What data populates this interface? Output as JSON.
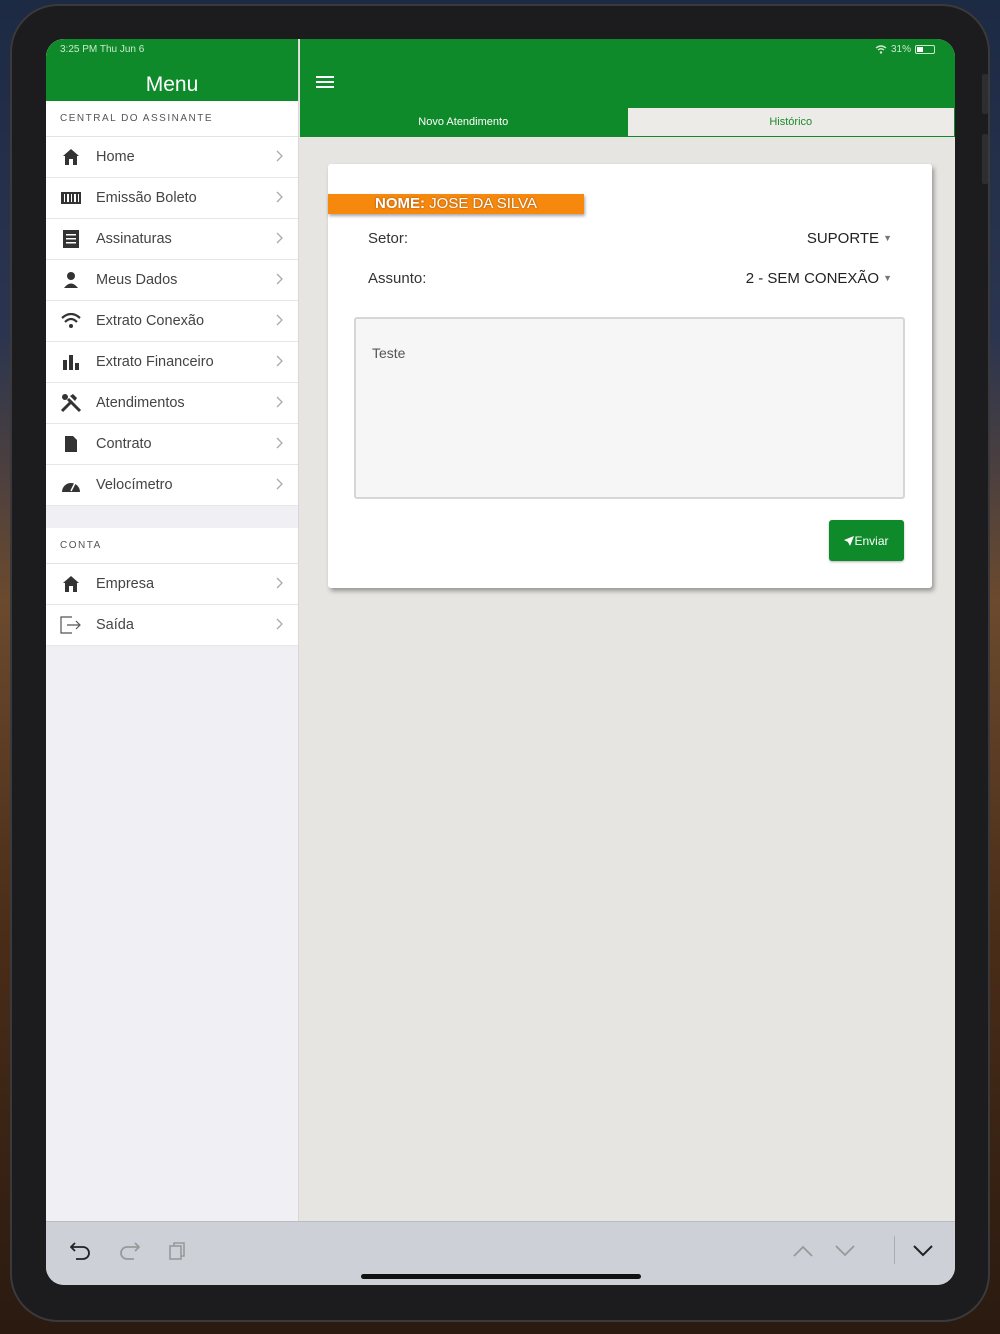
{
  "status": {
    "time": "3:25 PM  Thu Jun 6",
    "battery": "31%"
  },
  "sidebar": {
    "title": "Menu",
    "section1": "CENTRAL DO ASSINANTE",
    "items": [
      {
        "label": "Home",
        "icon": "home-icon"
      },
      {
        "label": "Emissão Boleto",
        "icon": "barcode-icon"
      },
      {
        "label": "Assinaturas",
        "icon": "document-list-icon"
      },
      {
        "label": "Meus Dados",
        "icon": "user-icon"
      },
      {
        "label": "Extrato Conexão",
        "icon": "wifi-icon"
      },
      {
        "label": "Extrato Financeiro",
        "icon": "bar-chart-icon"
      },
      {
        "label": "Atendimentos",
        "icon": "tools-icon"
      },
      {
        "label": "Contrato",
        "icon": "file-icon"
      },
      {
        "label": "Velocímetro",
        "icon": "speedometer-icon"
      }
    ],
    "section2": "CONTA",
    "account_items": [
      {
        "label": "Empresa",
        "icon": "home-icon"
      },
      {
        "label": "Saída",
        "icon": "logout-icon"
      }
    ]
  },
  "tabs": [
    {
      "label": "Novo Atendimento",
      "active": true
    },
    {
      "label": "Histórico",
      "active": false
    }
  ],
  "form": {
    "name_label": "NOME:",
    "name_value": "JOSE DA SILVA",
    "setor_label": "Setor:",
    "setor_value": "SUPORTE",
    "assunto_label": "Assunto:",
    "assunto_value": "2 - SEM CONEXÃO",
    "message": "Teste",
    "send_label": "Enviar"
  },
  "colors": {
    "brand": "#0f8a2a",
    "badge": "#f7880e"
  }
}
